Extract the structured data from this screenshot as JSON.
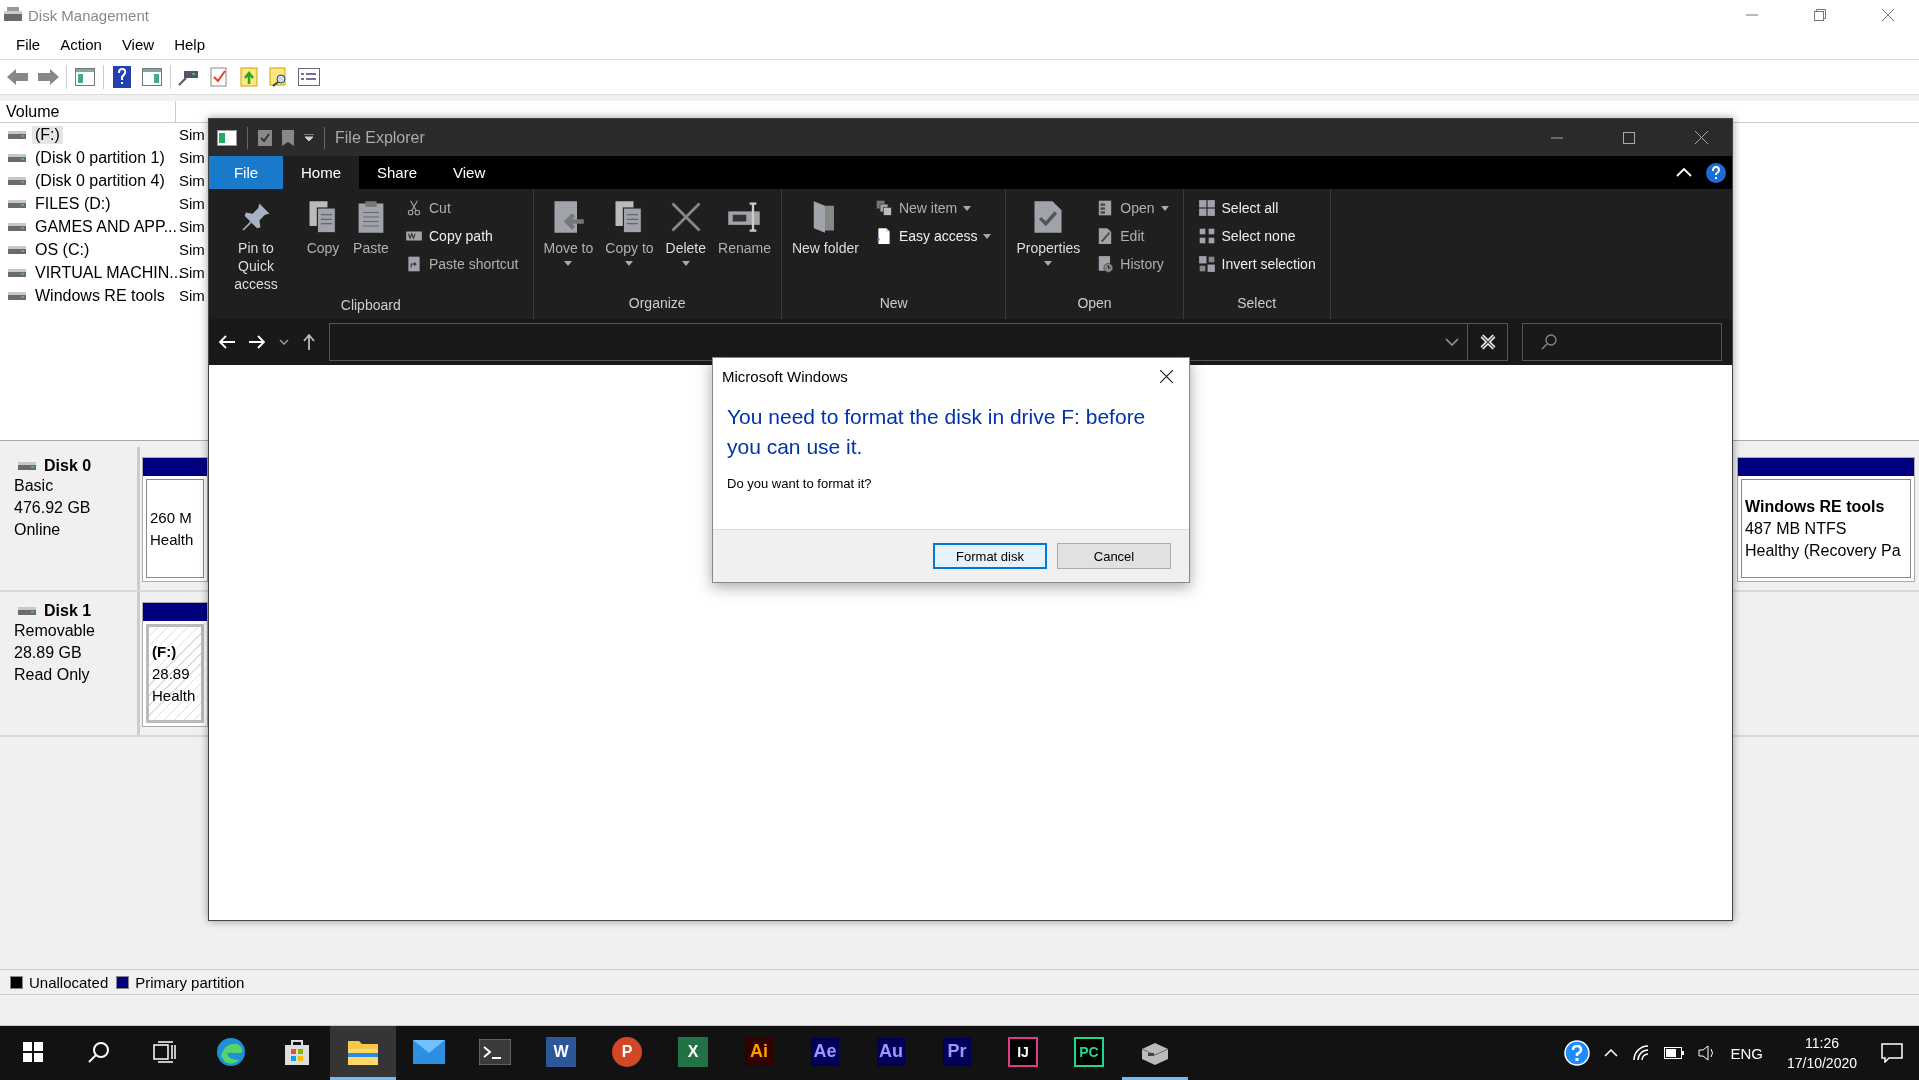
{
  "disk_management": {
    "title": "Disk Management",
    "menu": [
      "File",
      "Action",
      "View",
      "Help"
    ],
    "volume_table": {
      "columns": [
        "Volume"
      ],
      "rows": [
        {
          "volume": "(F:)",
          "layout": "Sim",
          "selected": true
        },
        {
          "volume": "(Disk 0 partition 1)",
          "layout": "Sim",
          "selected": false
        },
        {
          "volume": "(Disk 0 partition 4)",
          "layout": "Sim",
          "selected": false
        },
        {
          "volume": "FILES (D:)",
          "layout": "Sim",
          "selected": false
        },
        {
          "volume": "GAMES AND APP...",
          "layout": "Sim",
          "selected": false
        },
        {
          "volume": "OS (C:)",
          "layout": "Sim",
          "selected": false
        },
        {
          "volume": "VIRTUAL MACHIN...",
          "layout": "Sim",
          "selected": false
        },
        {
          "volume": "Windows RE tools",
          "layout": "Sim",
          "selected": false
        }
      ]
    },
    "disks": [
      {
        "name": "Disk 0",
        "lines": [
          "Basic",
          "476.92 GB",
          "Online"
        ],
        "partitions": [
          {
            "kind": "start",
            "lines": [
              "260 M",
              "Health"
            ],
            "selected": false
          },
          {
            "kind": "end",
            "name": "Windows RE tools",
            "lines": [
              "487 MB NTFS",
              "Healthy (Recovery Pa"
            ],
            "selected": false
          }
        ]
      },
      {
        "name": "Disk 1",
        "lines": [
          "Removable",
          "28.89 GB",
          "Read Only"
        ],
        "partitions": [
          {
            "kind": "start",
            "name": "(F:)",
            "lines": [
              "28.89",
              "Health"
            ],
            "selected": true
          }
        ]
      }
    ],
    "legend": [
      {
        "label": "Unallocated",
        "color": "#000000"
      },
      {
        "label": "Primary partition",
        "color": "#000080"
      }
    ]
  },
  "file_explorer": {
    "title": "File Explorer",
    "tabs": [
      {
        "label": "File",
        "kind": "backstage",
        "selected": false
      },
      {
        "label": "Home",
        "kind": "tab",
        "selected": true
      },
      {
        "label": "Share",
        "kind": "tab",
        "selected": false
      },
      {
        "label": "View",
        "kind": "tab",
        "selected": false
      }
    ],
    "groups": [
      {
        "label": "Clipboard",
        "items": [
          {
            "kind": "large",
            "label": "Pin to Quick access",
            "disabled": false
          },
          {
            "kind": "large",
            "label": "Copy",
            "disabled": true
          },
          {
            "kind": "large",
            "label": "Paste",
            "disabled": true
          },
          {
            "kind": "small",
            "label": "Cut",
            "disabled": true
          },
          {
            "kind": "small",
            "label": "Copy path",
            "disabled": false
          },
          {
            "kind": "small",
            "label": "Paste shortcut",
            "disabled": true
          }
        ]
      },
      {
        "label": "Organize",
        "items": [
          {
            "kind": "large",
            "label": "Move to",
            "dropdown": true,
            "disabled": true
          },
          {
            "kind": "large",
            "label": "Copy to",
            "dropdown": true,
            "disabled": true
          },
          {
            "kind": "large",
            "label": "Delete",
            "dropdown": true,
            "disabled": false
          },
          {
            "kind": "large",
            "label": "Rename",
            "disabled": true
          }
        ]
      },
      {
        "label": "New",
        "items": [
          {
            "kind": "large",
            "label": "New folder",
            "disabled": false
          },
          {
            "kind": "small",
            "label": "New item",
            "dropdown": true,
            "disabled": true
          },
          {
            "kind": "small",
            "label": "Easy access",
            "dropdown": true,
            "disabled": false
          }
        ]
      },
      {
        "label": "Open",
        "items": [
          {
            "kind": "large",
            "label": "Properties",
            "dropdown": true,
            "disabled": false
          },
          {
            "kind": "small",
            "label": "Open",
            "dropdown": true,
            "disabled": true
          },
          {
            "kind": "small",
            "label": "Edit",
            "disabled": true
          },
          {
            "kind": "small",
            "label": "History",
            "disabled": true
          }
        ]
      },
      {
        "label": "Select",
        "items": [
          {
            "kind": "small",
            "label": "Select all",
            "disabled": false
          },
          {
            "kind": "small",
            "label": "Select none",
            "disabled": false
          },
          {
            "kind": "small",
            "label": "Invert selection",
            "disabled": false
          }
        ]
      }
    ]
  },
  "dialog": {
    "title": "Microsoft Windows",
    "heading": "You need to format the disk in drive F: before you can use it.",
    "message": "Do you want to format it?",
    "buttons": [
      {
        "label": "Format disk",
        "default": true
      },
      {
        "label": "Cancel",
        "default": false
      }
    ]
  },
  "taskbar": {
    "apps": [
      {
        "kind": "edge",
        "selected": false,
        "open": false
      },
      {
        "kind": "store",
        "selected": false,
        "open": false
      },
      {
        "kind": "folder",
        "selected": true,
        "open": true
      },
      {
        "kind": "mail",
        "selected": false,
        "open": false
      },
      {
        "kind": "terminal",
        "selected": false,
        "open": false
      },
      {
        "kind": "doc",
        "label": "W",
        "color": "#2b579a",
        "selected": false,
        "open": false
      },
      {
        "kind": "round",
        "label": "P",
        "color": "#d24726",
        "selected": false,
        "open": false
      },
      {
        "kind": "doc",
        "label": "X",
        "color": "#217346",
        "selected": false,
        "open": false
      },
      {
        "kind": "tile",
        "label": "Ai",
        "color": "#330000",
        "selected": false,
        "open": false
      },
      {
        "kind": "tile",
        "label": "Ae",
        "color": "#00005b",
        "selected": false,
        "open": false
      },
      {
        "kind": "tile",
        "label": "Au",
        "color": "#00005b",
        "selected": false,
        "open": false
      },
      {
        "kind": "tile",
        "label": "Pr",
        "color": "#00005b",
        "selected": false,
        "open": false
      },
      {
        "kind": "tile",
        "label": "IJ",
        "color": "#000000",
        "selected": false,
        "open": false
      },
      {
        "kind": "tile",
        "label": "PC",
        "color": "#000000",
        "selected": false,
        "open": false
      },
      {
        "kind": "drive",
        "selected": false,
        "open": true
      }
    ],
    "language": "ENG",
    "time": "11:26",
    "date": "17/10/2020"
  }
}
